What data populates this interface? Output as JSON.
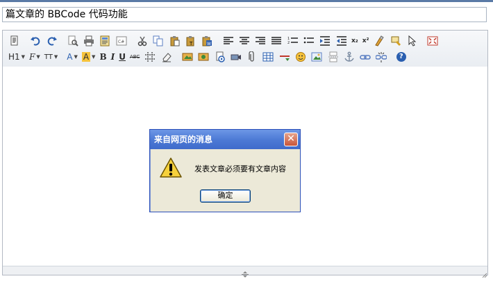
{
  "title_field": {
    "value": "篇文章的  BBCode 代码功能"
  },
  "toolbar": {
    "heading_label": "H1",
    "font_label": "F",
    "size_label": "TT",
    "font_color_label": "A",
    "highlight_label": "A",
    "bold_label": "B",
    "italic_label": "I",
    "underline_label": "U",
    "strike_label": "ABC",
    "subscript_label": "x₂",
    "superscript_label": "x²",
    "help_label": "?"
  },
  "dialog": {
    "title": "来自网页的消息",
    "message": "发表文章必须要有文章内容",
    "ok_label": "确定",
    "close_label": "✕",
    "icon": "warning-icon"
  },
  "colors": {
    "dialog_title_bg": "#4b78d4",
    "dialog_bg": "#ece9d8",
    "editor_border": "#b3b9c3"
  }
}
